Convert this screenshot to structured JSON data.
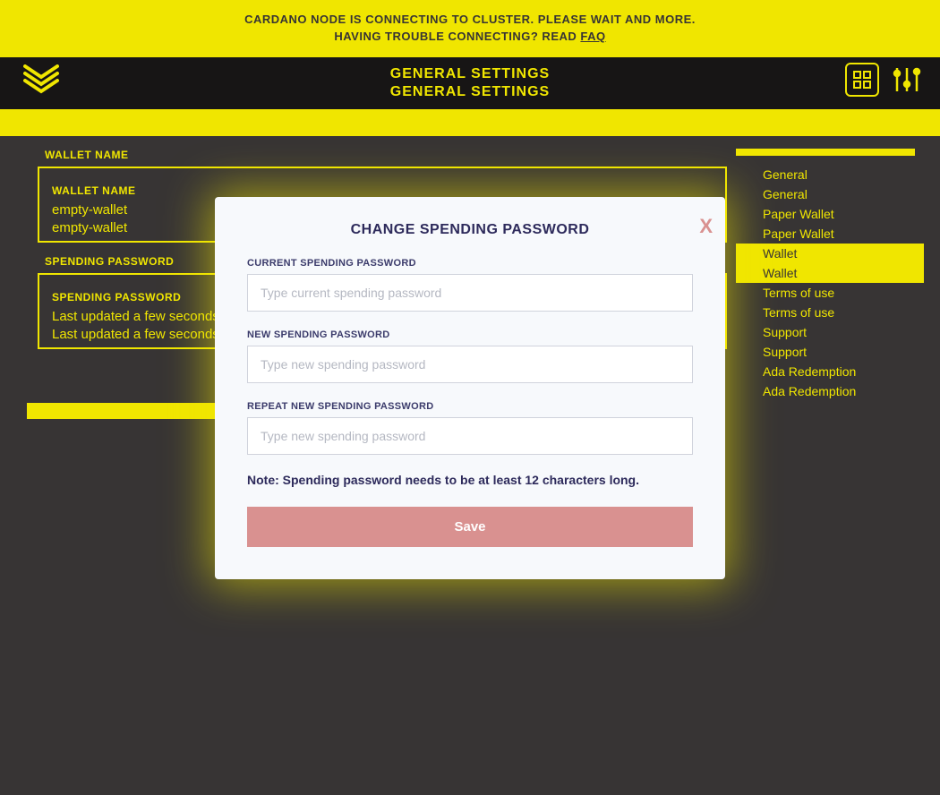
{
  "alert": {
    "line1": "CARDANO NODE IS CONNECTING TO CLUSTER. PLEASE WAIT AND MORE.",
    "prefix": "HAVING TROUBLE CONNECTING? READ",
    "faq": "FAQ"
  },
  "header": {
    "title": "GENERAL SETTINGS"
  },
  "settings": {
    "wallet_name_label": "WALLET NAME",
    "wallet_name_value": "empty-wallet",
    "spending_password_label": "SPENDING PASSWORD",
    "spending_password_value": "Last updated a few seconds ago"
  },
  "sidebar": {
    "items": [
      {
        "label": "General",
        "active": false
      },
      {
        "label": "General",
        "active": false
      },
      {
        "label": "Paper Wallet",
        "active": false
      },
      {
        "label": "Paper Wallet",
        "active": false
      },
      {
        "label": "Wallet",
        "active": true
      },
      {
        "label": "Wallet",
        "active": true
      },
      {
        "label": "Terms of use",
        "active": false
      },
      {
        "label": "Terms of use",
        "active": false
      },
      {
        "label": "Support",
        "active": false
      },
      {
        "label": "Support",
        "active": false
      },
      {
        "label": "Ada Redemption",
        "active": false
      },
      {
        "label": "Ada Redemption",
        "active": false
      }
    ]
  },
  "modal": {
    "title": "CHANGE SPENDING PASSWORD",
    "close": "X",
    "current_label": "CURRENT SPENDING PASSWORD",
    "current_placeholder": "Type current spending password",
    "new_label": "NEW SPENDING PASSWORD",
    "new_placeholder": "Type new spending password",
    "repeat_label": "REPEAT NEW SPENDING PASSWORD",
    "repeat_placeholder": "Type new spending password",
    "note": "Note: Spending password needs to be at least 12 characters long.",
    "save": "Save"
  },
  "colors": {
    "accent": "#f0e600",
    "bg": "#373434",
    "modal_bg": "#f7f9fc",
    "danger": "#d99190",
    "modal_text": "#2d2a5b"
  }
}
